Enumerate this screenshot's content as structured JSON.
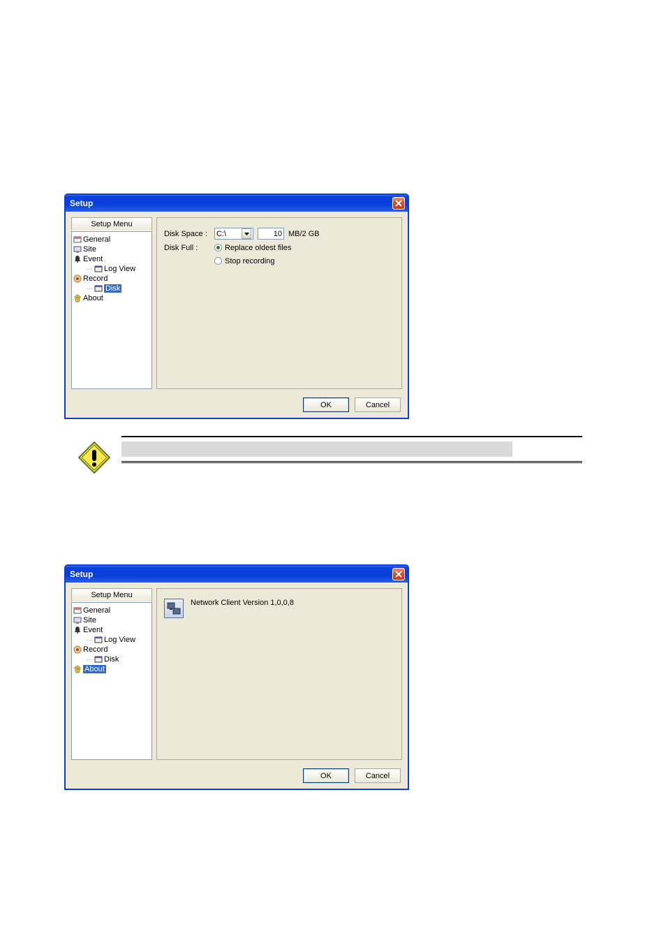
{
  "dialog1": {
    "title": "Setup",
    "side_header": "Setup Menu",
    "tree": {
      "general": "General",
      "site": "Site",
      "event": "Event",
      "logview": "Log View",
      "record": "Record",
      "disk": "Disk",
      "about": "About"
    },
    "disk_space_label": "Disk Space :",
    "disk_full_label": "Disk Full :",
    "drive_value": "C:\\",
    "mb_value": "10",
    "mb_suffix": "MB/2 GB",
    "radio_replace": "Replace oldest files",
    "radio_stop": "Stop recording",
    "ok": "OK",
    "cancel": "Cancel"
  },
  "dialog2": {
    "title": "Setup",
    "side_header": "Setup Menu",
    "tree": {
      "general": "General",
      "site": "Site",
      "event": "Event",
      "logview": "Log View",
      "record": "Record",
      "disk": "Disk",
      "about": "About"
    },
    "about_text": "Network Client Version 1,0,0,8",
    "ok": "OK",
    "cancel": "Cancel"
  }
}
